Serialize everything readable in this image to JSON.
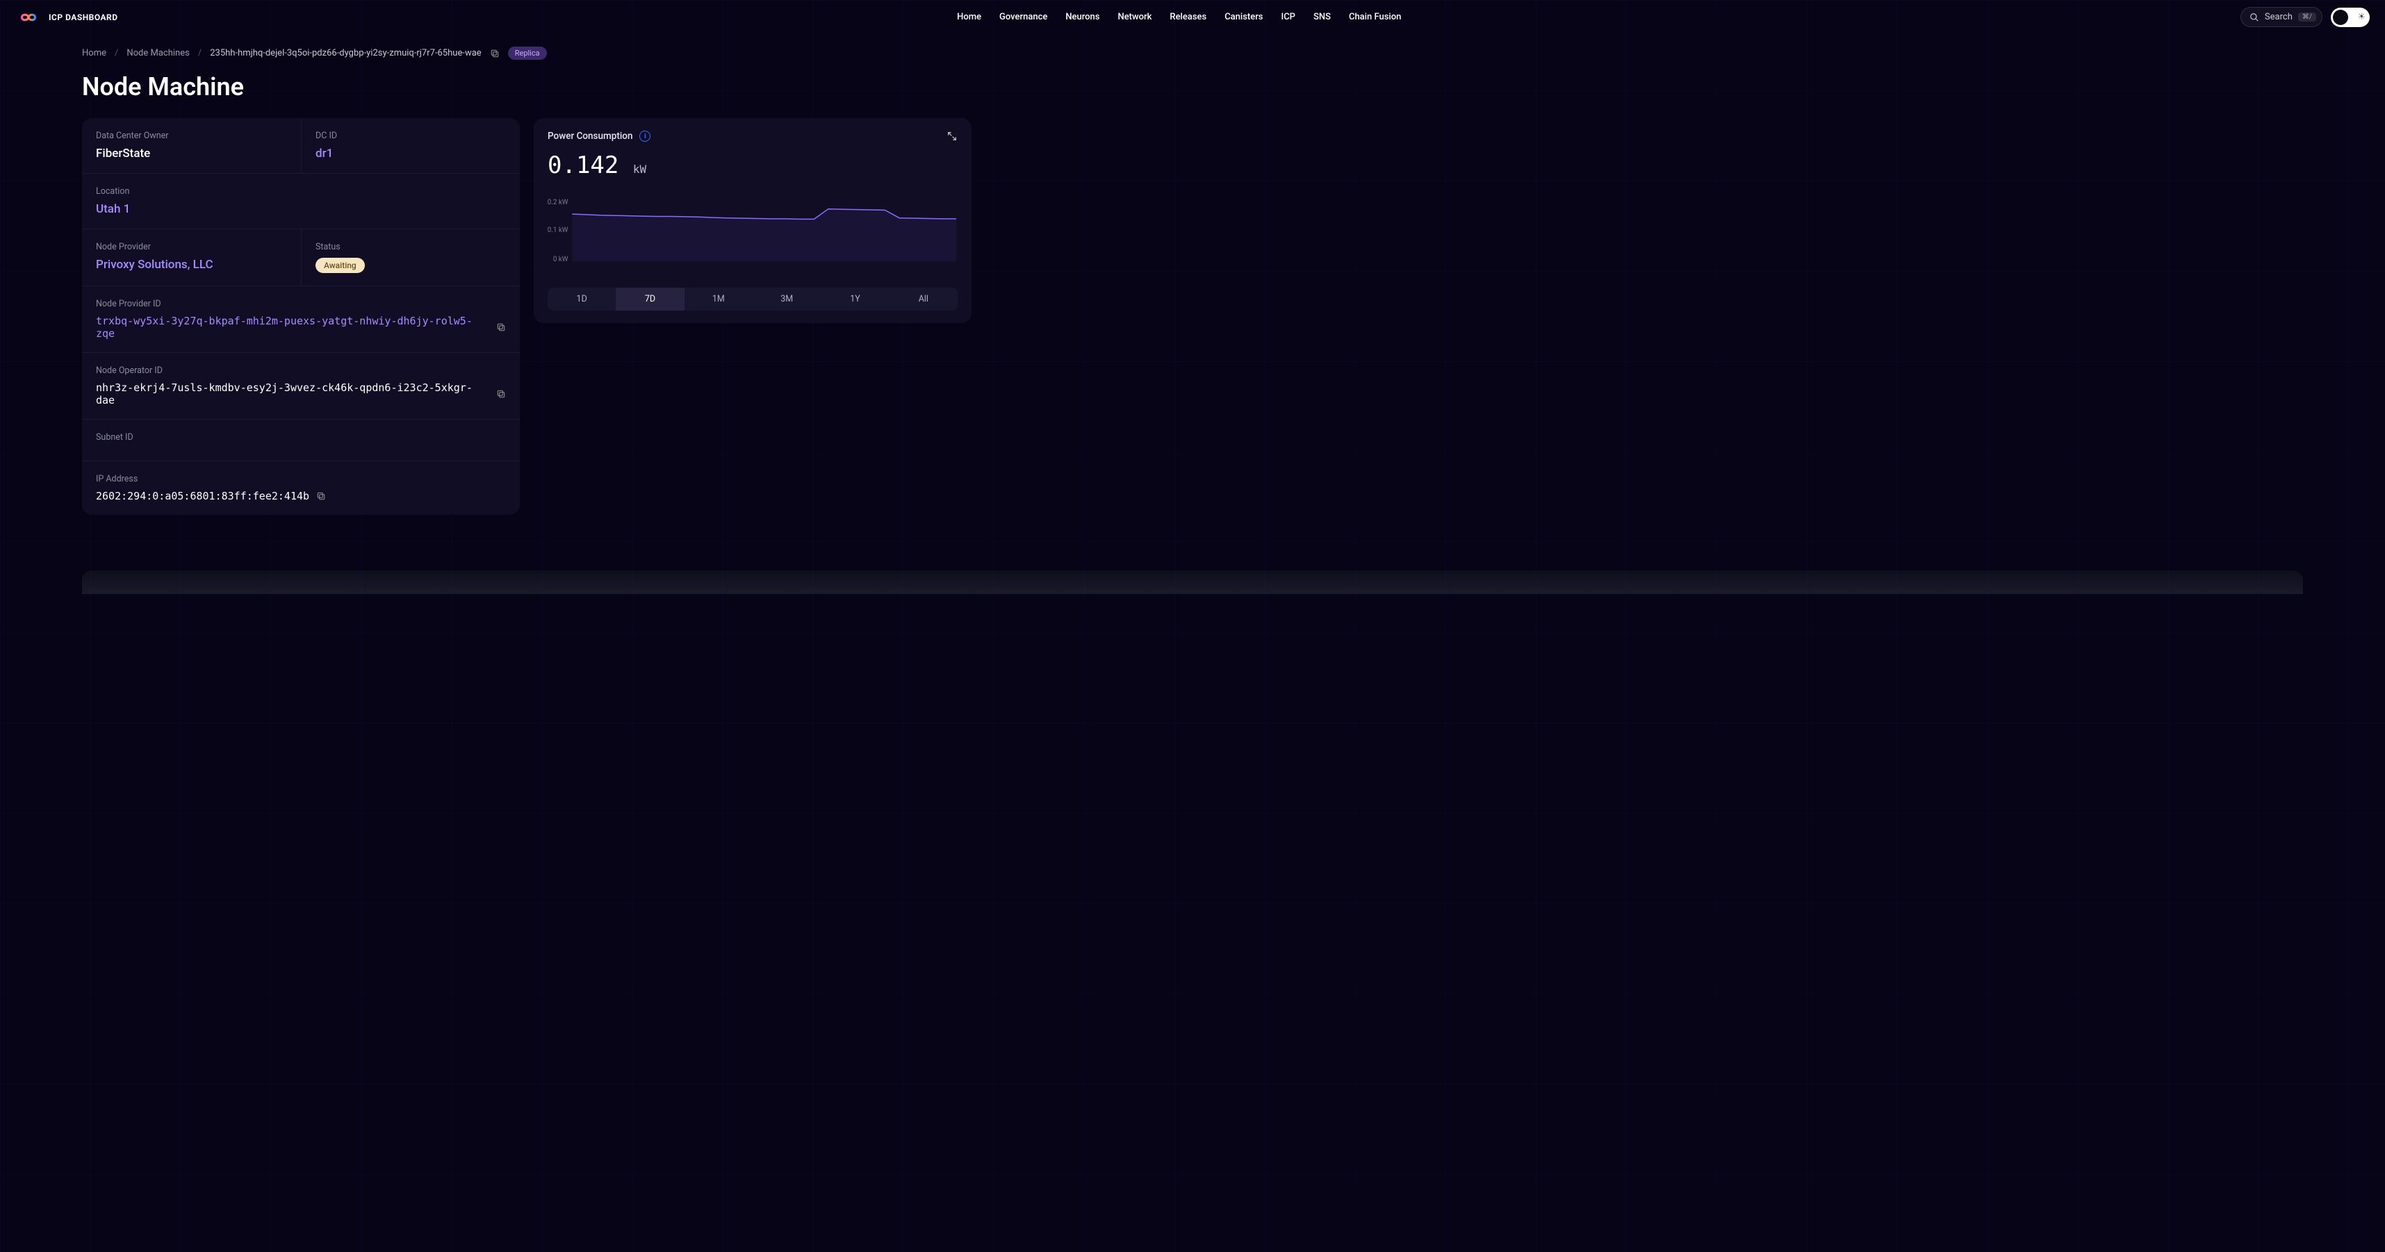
{
  "header": {
    "logo_text": "ICP DASHBOARD",
    "nav": [
      "Home",
      "Governance",
      "Neurons",
      "Network",
      "Releases",
      "Canisters",
      "ICP",
      "SNS",
      "Chain Fusion"
    ],
    "search_label": "Search",
    "search_kbd": "⌘/"
  },
  "breadcrumb": {
    "home": "Home",
    "parent": "Node Machines",
    "current": "235hh-hmjhq-dejel-3q5oi-pdz66-dygbp-yi2sy-zmuiq-rj7r7-65hue-wae",
    "badge": "Replica"
  },
  "title": "Node Machine",
  "info": {
    "data_center_owner_label": "Data Center Owner",
    "data_center_owner": "FiberState",
    "dc_id_label": "DC ID",
    "dc_id": "dr1",
    "location_label": "Location",
    "location": "Utah 1",
    "node_provider_label": "Node Provider",
    "node_provider": "Privoxy Solutions, LLC",
    "status_label": "Status",
    "status": "Awaiting",
    "node_provider_id_label": "Node Provider ID",
    "node_provider_id": "trxbq-wy5xi-3y27q-bkpaf-mhi2m-puexs-yatgt-nhwiy-dh6jy-rolw5-zqe",
    "node_operator_id_label": "Node Operator ID",
    "node_operator_id": "nhr3z-ekrj4-7usls-kmdbv-esy2j-3wvez-ck46k-qpdn6-i23c2-5xkgr-dae",
    "subnet_id_label": "Subnet ID",
    "ip_label": "IP Address",
    "ip": "2602:294:0:a05:6801:83ff:fee2:414b"
  },
  "power": {
    "title": "Power Consumption",
    "value": "0.142",
    "unit": "kW",
    "y_ticks": [
      "0.2 kW",
      "0.1 kW",
      "0 kW"
    ],
    "ranges": [
      "1D",
      "7D",
      "1M",
      "3M",
      "1Y",
      "All"
    ],
    "active_range": "7D"
  },
  "chart_data": {
    "type": "line",
    "title": "Power Consumption",
    "xlabel": "",
    "ylabel": "kW",
    "ylim": [
      0,
      0.2
    ],
    "x": [
      0,
      1,
      2,
      3,
      4,
      5,
      6,
      7,
      8,
      9,
      10,
      11,
      12,
      13,
      14,
      15,
      16,
      17,
      18,
      19,
      20,
      21,
      22,
      23,
      24,
      25,
      26,
      27
    ],
    "values": [
      0.158,
      0.156,
      0.154,
      0.153,
      0.152,
      0.151,
      0.15,
      0.15,
      0.149,
      0.148,
      0.146,
      0.145,
      0.144,
      0.143,
      0.142,
      0.142,
      0.141,
      0.141,
      0.175,
      0.174,
      0.173,
      0.172,
      0.171,
      0.145,
      0.144,
      0.143,
      0.142,
      0.142
    ]
  }
}
